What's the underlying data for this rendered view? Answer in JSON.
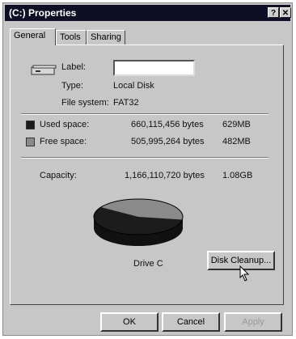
{
  "window": {
    "title": "(C:) Properties",
    "help_glyph": "?",
    "close_glyph": "✕"
  },
  "tabs": [
    {
      "label": "General"
    },
    {
      "label": "Tools"
    },
    {
      "label": "Sharing"
    }
  ],
  "general": {
    "label_caption": "Label:",
    "label_value": "",
    "type_caption": "Type:",
    "type_value": "Local Disk",
    "fs_caption": "File system:",
    "fs_value": "FAT32",
    "used": {
      "caption": "Used space:",
      "bytes": "660,115,456 bytes",
      "size": "629MB",
      "color": "#1c1c1c"
    },
    "free": {
      "caption": "Free space:",
      "bytes": "505,995,264 bytes",
      "size": "482MB",
      "color": "#8a8a8a"
    },
    "capacity": {
      "caption": "Capacity:",
      "bytes": "1,166,110,720 bytes",
      "size": "1.08GB"
    },
    "drive_label": "Drive C",
    "cleanup_button": "Disk Cleanup...",
    "used_fraction": 0.566
  },
  "footer": {
    "ok": "OK",
    "cancel": "Cancel",
    "apply": "Apply"
  },
  "icons": {
    "help": "help-icon",
    "close": "close-icon",
    "drive": "hard-drive-icon",
    "cursor": "mouse-pointer-icon"
  }
}
